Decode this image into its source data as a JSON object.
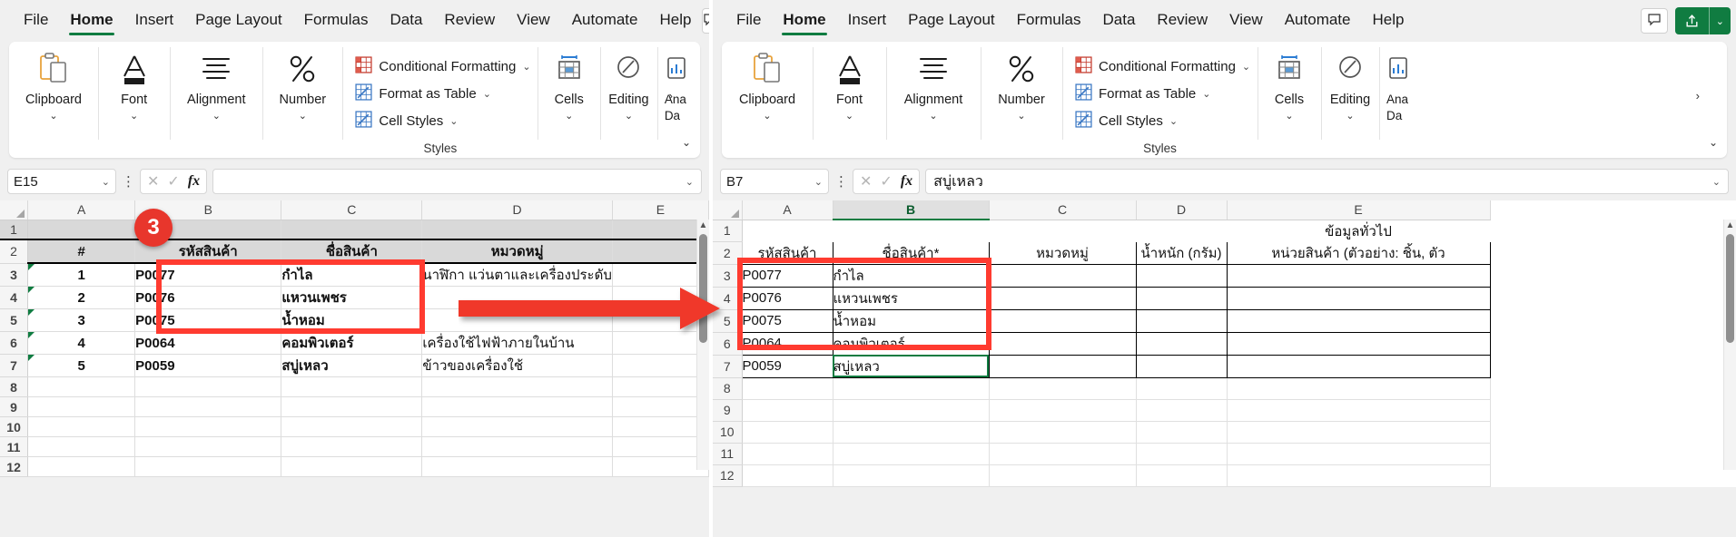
{
  "app": {
    "name": "Excel"
  },
  "ribbon_tabs": [
    "File",
    "Home",
    "Insert",
    "Page Layout",
    "Formulas",
    "Data",
    "Review",
    "View",
    "Automate",
    "Help"
  ],
  "active_tab": "Home",
  "titlebar_actions": {
    "comment_icon": "comment-icon",
    "share_label": "Share",
    "share_icon": "share-icon",
    "share_caret": "⌄"
  },
  "ribbon_groups": [
    {
      "label": "Clipboard",
      "icon": "clipboard-icon",
      "caret": "⌄"
    },
    {
      "label": "Font",
      "icon": "font-a-icon",
      "caret": "⌄"
    },
    {
      "label": "Alignment",
      "icon": "alignment-lines-icon",
      "caret": "⌄"
    },
    {
      "label": "Number",
      "icon": "percent-icon",
      "caret": "⌄"
    },
    {
      "label": "Cells",
      "icon": "cells-table-icon",
      "caret": "⌄"
    },
    {
      "label": "Editing",
      "icon": "editing-pencil-icon",
      "caret": "⌄"
    }
  ],
  "styles_group": {
    "caption": "Styles",
    "items": [
      {
        "label": "Conditional Formatting",
        "icon": "conditional-formatting-icon",
        "caret": "⌄"
      },
      {
        "label": "Format as Table",
        "icon": "format-as-table-icon",
        "caret": "⌄"
      },
      {
        "label": "Cell Styles",
        "icon": "cell-styles-icon",
        "caret": "⌄"
      }
    ]
  },
  "analyze_group": {
    "label_line1": "Ana",
    "label_line2": "Da",
    "icon": "analyze-data-icon",
    "overflow_caret": "›"
  },
  "ribbon_overflow_caret": "⌄",
  "left_pane": {
    "name_box": {
      "value": "E15",
      "caret": "⌄"
    },
    "formula_bar": {
      "value": "",
      "cancel_icon": "cancel-x-icon",
      "confirm_icon": "confirm-check-icon",
      "fx_icon": "fx-icon",
      "expand_caret": "⌄"
    },
    "columns": [
      "A",
      "B",
      "C",
      "D",
      "E"
    ],
    "row_numbers": [
      "1",
      "2",
      "3",
      "4",
      "5",
      "6",
      "7",
      "8",
      "9",
      "10",
      "11",
      "12"
    ],
    "rows": [
      {
        "num": "1",
        "cells": [
          "",
          "",
          "",
          "",
          ""
        ]
      },
      {
        "num": "2",
        "cells": [
          "#",
          "รหัสสินค้า",
          "ชื่อสินค้า",
          "หมวดหมู่",
          ""
        ]
      },
      {
        "num": "3",
        "cells": [
          "1",
          "P0077",
          "กำไล",
          "นาฬิกา แว่นตาและเครื่องประดับ",
          ""
        ]
      },
      {
        "num": "4",
        "cells": [
          "2",
          "P0076",
          "แหวนเพชร",
          "",
          ""
        ]
      },
      {
        "num": "5",
        "cells": [
          "3",
          "P0075",
          "น้ำหอม",
          "",
          ""
        ]
      },
      {
        "num": "6",
        "cells": [
          "4",
          "P0064",
          "คอมพิวเตอร์",
          "เครื่องใช้ไฟฟ้าภายในบ้าน",
          ""
        ]
      },
      {
        "num": "7",
        "cells": [
          "5",
          "P0059",
          "สบู่เหลว",
          "ข้าวของเครื่องใช้",
          ""
        ]
      },
      {
        "num": "8",
        "cells": [
          "",
          "",
          "",
          "",
          ""
        ]
      },
      {
        "num": "9",
        "cells": [
          "",
          "",
          "",
          "",
          ""
        ]
      },
      {
        "num": "10",
        "cells": [
          "",
          "",
          "",
          "",
          ""
        ]
      },
      {
        "num": "11",
        "cells": [
          "",
          "",
          "",
          "",
          ""
        ]
      },
      {
        "num": "12",
        "cells": [
          "",
          "",
          "",
          "",
          ""
        ]
      }
    ]
  },
  "right_pane": {
    "name_box": {
      "value": "B7",
      "caret": "⌄"
    },
    "formula_bar": {
      "value": "สบู่เหลว",
      "cancel_icon": "cancel-x-icon",
      "confirm_icon": "confirm-check-icon",
      "fx_icon": "fx-icon",
      "expand_caret": "⌄"
    },
    "columns": [
      "A",
      "B",
      "C",
      "D",
      "E"
    ],
    "selected_column": "B",
    "row_numbers": [
      "1",
      "2",
      "3",
      "4",
      "5",
      "6",
      "7",
      "8",
      "9",
      "10",
      "11",
      "12"
    ],
    "rows": [
      {
        "num": "1",
        "cells": [
          "",
          "",
          "",
          "",
          "ข้อมูลทั่วไป"
        ]
      },
      {
        "num": "2",
        "cells": [
          "รหัสสินค้า",
          "ชื่อสินค้า*",
          "หมวดหมู่",
          "น้ำหนัก (กรัม)",
          "หน่วยสินค้า (ตัวอย่าง: ชิ้น, ตัว"
        ]
      },
      {
        "num": "3",
        "cells": [
          "P0077",
          "กำไล",
          "",
          "",
          ""
        ]
      },
      {
        "num": "4",
        "cells": [
          "P0076",
          "แหวนเพชร",
          "",
          "",
          ""
        ]
      },
      {
        "num": "5",
        "cells": [
          "P0075",
          "น้ำหอม",
          "",
          "",
          ""
        ]
      },
      {
        "num": "6",
        "cells": [
          "P0064",
          "คอมพิวเตอร์",
          "",
          "",
          ""
        ]
      },
      {
        "num": "7",
        "cells": [
          "P0059",
          "สบู่เหลว",
          "",
          "",
          ""
        ]
      },
      {
        "num": "8",
        "cells": [
          "",
          "",
          "",
          "",
          ""
        ]
      },
      {
        "num": "9",
        "cells": [
          "",
          "",
          "",
          "",
          ""
        ]
      },
      {
        "num": "10",
        "cells": [
          "",
          "",
          "",
          "",
          ""
        ]
      },
      {
        "num": "11",
        "cells": [
          "",
          "",
          "",
          "",
          ""
        ]
      },
      {
        "num": "12",
        "cells": [
          "",
          "",
          "",
          "",
          ""
        ]
      }
    ]
  },
  "annotations": {
    "step_badge": "3",
    "highlight_color": "#ff3b30",
    "arrow_icon": "right-arrow-annotation"
  }
}
